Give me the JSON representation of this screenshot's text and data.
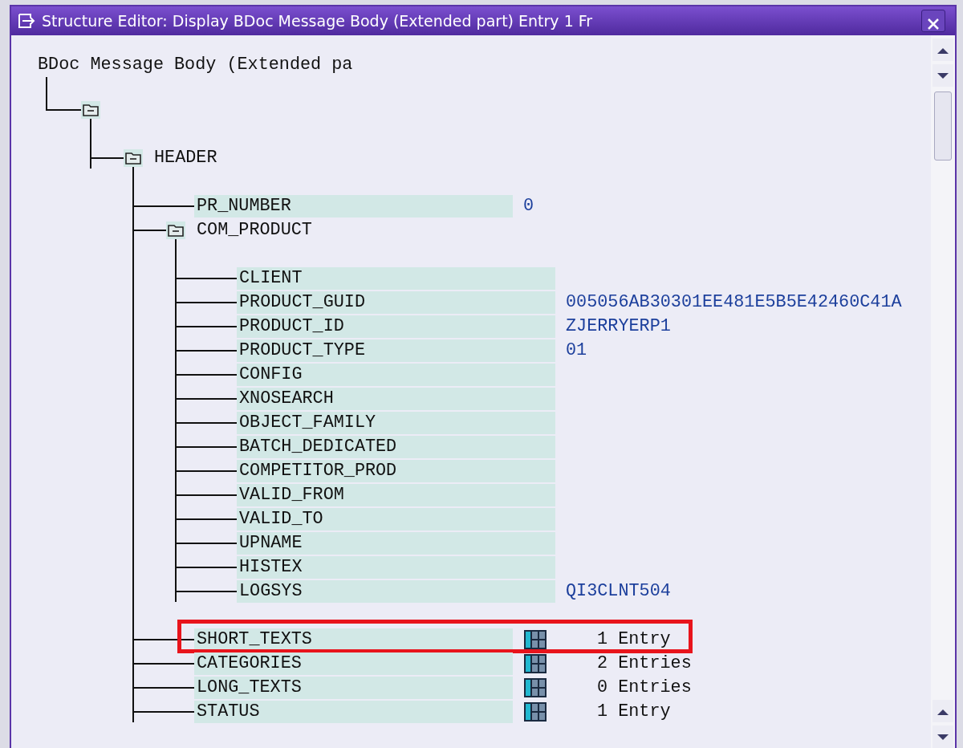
{
  "window": {
    "title": "Structure Editor: Display BDoc Message Body (Extended part) Entry 1 Fr"
  },
  "tree": {
    "label": "BDoc Message Body (Extended pa",
    "children": [
      {
        "kind": "folder",
        "children": [
          {
            "kind": "folder",
            "label": "HEADER",
            "children": [
              {
                "kind": "field",
                "label": "PR_NUMBER",
                "value": "0"
              },
              {
                "kind": "folder",
                "label": "COM_PRODUCT",
                "children": [
                  {
                    "kind": "field",
                    "label": "CLIENT"
                  },
                  {
                    "kind": "field",
                    "label": "PRODUCT_GUID",
                    "value": "005056AB30301EE481E5B5E42460C41A"
                  },
                  {
                    "kind": "field",
                    "label": "PRODUCT_ID",
                    "value": "ZJERRYERP1"
                  },
                  {
                    "kind": "field",
                    "label": "PRODUCT_TYPE",
                    "value": "01"
                  },
                  {
                    "kind": "field",
                    "label": "CONFIG"
                  },
                  {
                    "kind": "field",
                    "label": "XNOSEARCH"
                  },
                  {
                    "kind": "field",
                    "label": "OBJECT_FAMILY"
                  },
                  {
                    "kind": "field",
                    "label": "BATCH_DEDICATED"
                  },
                  {
                    "kind": "field",
                    "label": "COMPETITOR_PROD"
                  },
                  {
                    "kind": "field",
                    "label": "VALID_FROM"
                  },
                  {
                    "kind": "field",
                    "label": "VALID_TO"
                  },
                  {
                    "kind": "field",
                    "label": "UPNAME"
                  },
                  {
                    "kind": "field",
                    "label": "HISTEX"
                  },
                  {
                    "kind": "field",
                    "label": "LOGSYS",
                    "value": "QI3CLNT504"
                  }
                ]
              },
              {
                "kind": "table",
                "label": "SHORT_TEXTS",
                "count": "1 Entry",
                "highlighted": true
              },
              {
                "kind": "table",
                "label": "CATEGORIES",
                "count": "2 Entries",
                "highlighted": false
              },
              {
                "kind": "table",
                "label": "LONG_TEXTS",
                "count": "0 Entries",
                "highlighted": false
              },
              {
                "kind": "table",
                "label": "STATUS",
                "count": "1 Entry",
                "highlighted": false
              }
            ]
          }
        ]
      }
    ]
  }
}
